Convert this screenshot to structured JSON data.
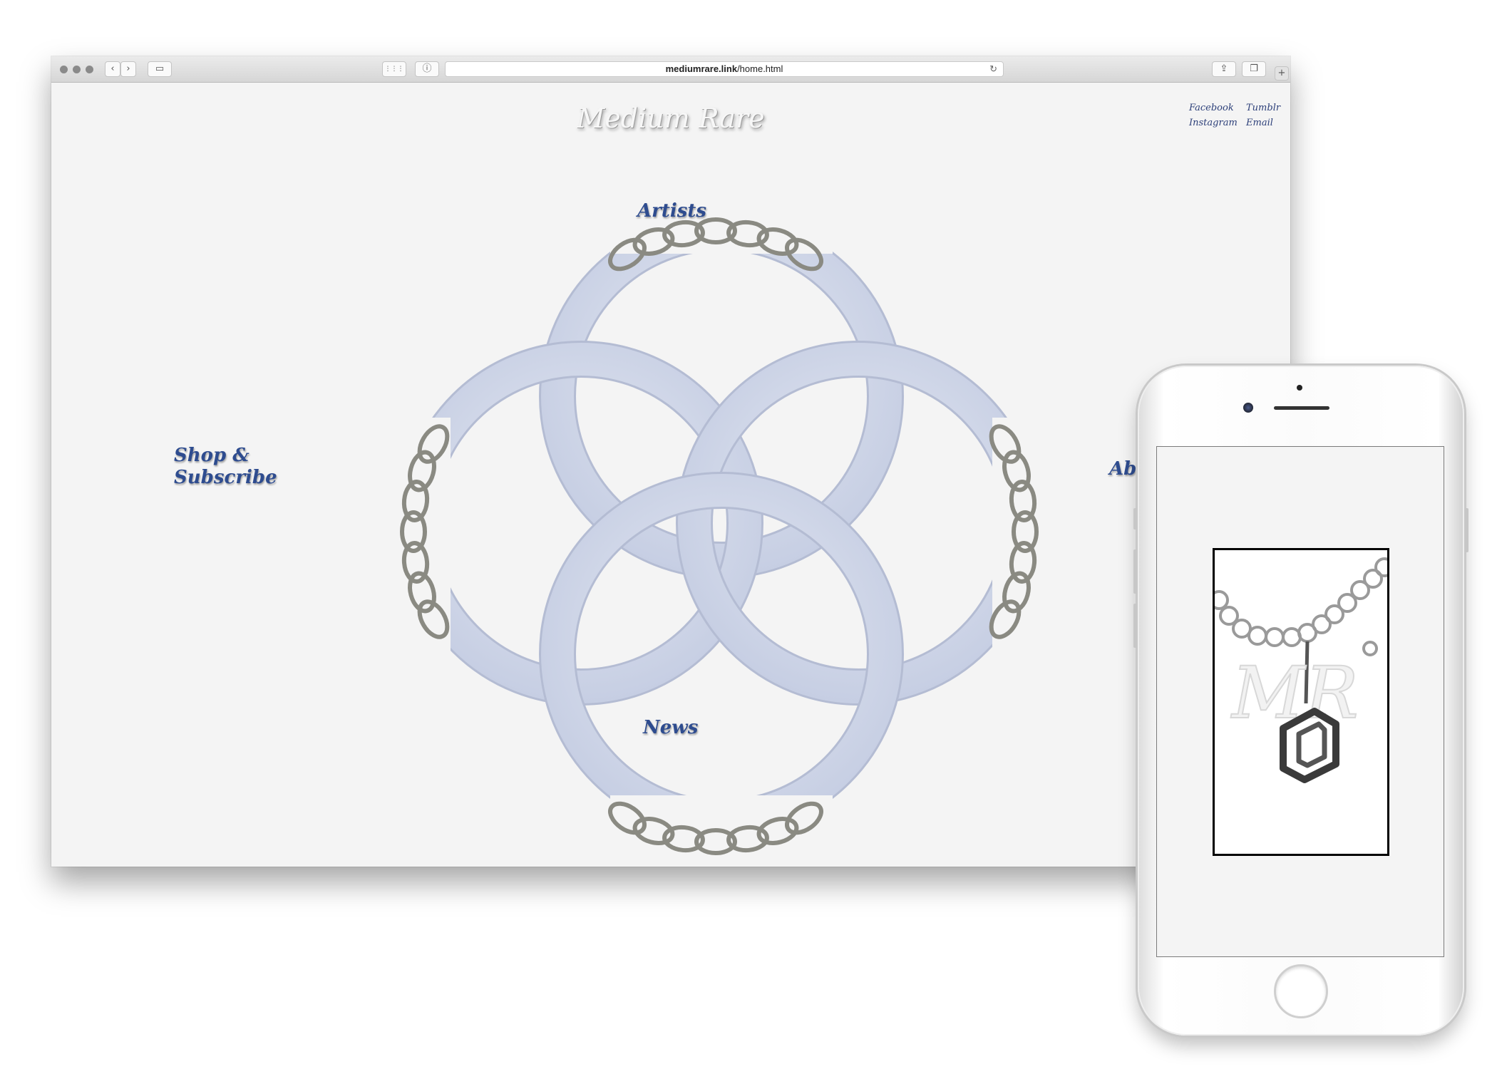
{
  "browser": {
    "url_host": "mediumrare.link",
    "url_path": "/home.html",
    "buttons": {
      "back": "‹",
      "forward": "›",
      "sidebar": "▭",
      "top_sites": "⋮⋮⋮",
      "site_info": "ⓘ",
      "reload": "↻",
      "share": "⇪",
      "tabs": "❐",
      "new_tab": "+"
    }
  },
  "site": {
    "title": "Medium Rare",
    "social": {
      "facebook": "Facebook",
      "tumblr": "Tumblr",
      "instagram": "Instagram",
      "email": "Email"
    },
    "nav": {
      "artists": "Artists",
      "news": "News",
      "shop_line1": "Shop &",
      "shop_line2": "Subscribe",
      "about": "Ab"
    }
  },
  "phone": {
    "monogram": "MR"
  },
  "colors": {
    "ring_fill": "#d3d9ea",
    "ring_stroke": "#aab3cc",
    "chain": "#8a8a82",
    "nav_text": "#2e4c8f",
    "social_text": "#2c3f79"
  }
}
